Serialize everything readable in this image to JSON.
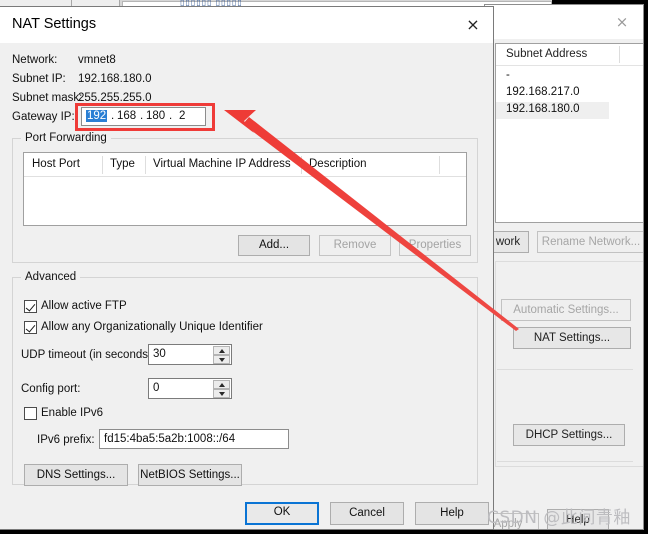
{
  "background_app": {
    "close_icon": "×",
    "list": {
      "header": "Subnet Address",
      "rows": [
        "-",
        "192.168.217.0",
        "192.168.180.0"
      ],
      "selected_index": 2
    },
    "buttons": {
      "rename_network": "Rename Network...",
      "add_network_partial": "work",
      "automatic_settings": "Automatic Settings...",
      "nat_settings": "NAT Settings...",
      "dhcp_settings": "DHCP Settings...",
      "apply": "Apply",
      "help": "Help"
    }
  },
  "dialog": {
    "title": "NAT Settings",
    "close_icon": "×",
    "fields": {
      "network_label": "Network:",
      "network_value": "vmnet8",
      "subnet_ip_label": "Subnet IP:",
      "subnet_ip_value": "192.168.180.0",
      "subnet_mask_label": "Subnet mask:",
      "subnet_mask_value": "255.255.255.0",
      "gateway_ip_label": "Gateway IP:",
      "gateway_octets": [
        "192",
        "168",
        "180",
        "2"
      ],
      "gateway_selected_octet": 0
    },
    "port_forwarding": {
      "legend": "Port Forwarding",
      "columns": [
        "Host Port",
        "Type",
        "Virtual Machine IP Address",
        "Description"
      ],
      "rows": [],
      "buttons": {
        "add": "Add...",
        "remove": "Remove",
        "properties": "Properties"
      }
    },
    "advanced": {
      "legend": "Advanced",
      "allow_active_ftp": {
        "label": "Allow active FTP",
        "checked": true
      },
      "allow_any_oui": {
        "label": "Allow any Organizationally Unique Identifier",
        "checked": true
      },
      "udp_timeout_label": "UDP timeout (in seconds):",
      "udp_timeout_value": "30",
      "config_port_label": "Config port:",
      "config_port_value": "0",
      "enable_ipv6": {
        "label": "Enable IPv6",
        "checked": false
      },
      "ipv6_prefix_label": "IPv6 prefix:",
      "ipv6_prefix_value": "fd15:4ba5:5a2b:1008::/64",
      "dns_settings_button": "DNS Settings...",
      "netbios_settings_button": "NetBIOS Settings..."
    },
    "footer": {
      "ok": "OK",
      "cancel": "Cancel",
      "help": "Help"
    }
  },
  "annotations": {
    "highlight_color": "#ef3b38",
    "arrow_color": "#ee3b36",
    "arrow_label": "red-arrow-pointing-to-gateway-ip"
  },
  "watermark": {
    "text": "CSDN @此间青釉"
  }
}
